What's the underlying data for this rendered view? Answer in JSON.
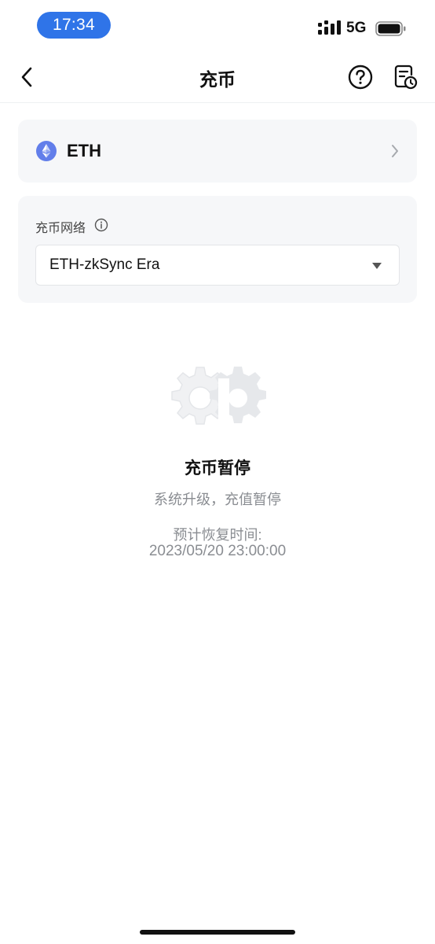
{
  "status_bar": {
    "time": "17:34",
    "network": "5G",
    "icons": [
      "signal-icon",
      "battery-icon"
    ]
  },
  "nav": {
    "title": "充币",
    "icons": [
      "back-chevron-icon",
      "help-question-icon",
      "history-record-icon"
    ]
  },
  "coin": {
    "symbol": "ETH",
    "icon": "ethereum-icon",
    "accent_color": "#627eea"
  },
  "network": {
    "label": "充币网络",
    "selected": "ETH-zkSync Era",
    "icons": [
      "info-icon",
      "dropdown-arrow-icon"
    ]
  },
  "maintenance": {
    "title": "充币暂停",
    "subtitle": "系统升级，充值暂停",
    "resume_label": "预计恢复时间:",
    "resume_time": "2023/05/20 23:00:00",
    "icon": "gear-maintenance-icon"
  },
  "colors": {
    "time_pill": "#2f74e8",
    "card_bg": "#f6f7f9",
    "muted_text": "#8a8d92"
  }
}
